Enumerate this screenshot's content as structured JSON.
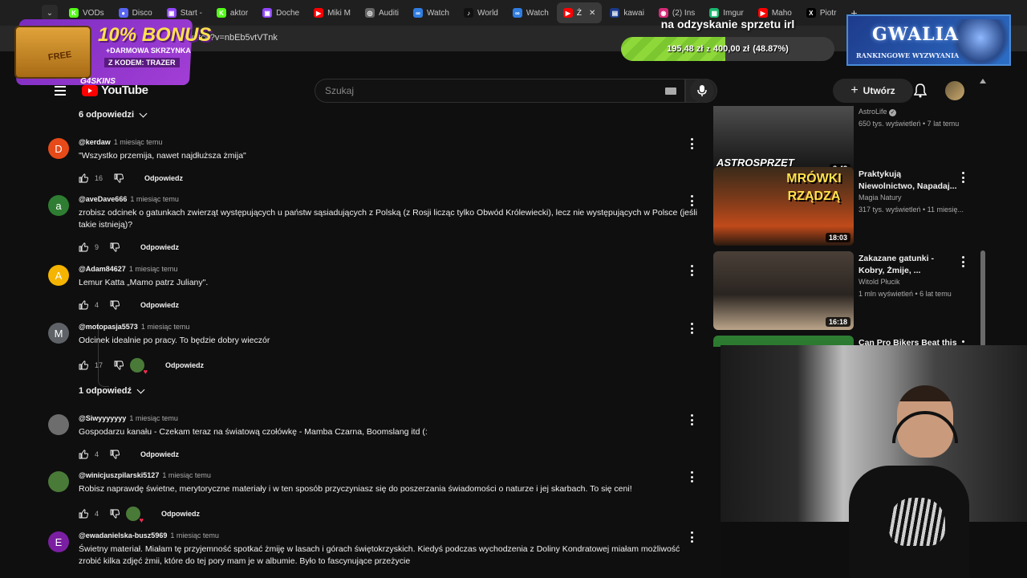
{
  "browser": {
    "tabs": [
      {
        "label": "",
        "color": "#3b3b3b",
        "glyph": "⌄",
        "active": false
      },
      {
        "label": "VODs",
        "color": "#53fc18",
        "glyph": "K",
        "active": false
      },
      {
        "label": "Disco",
        "color": "#5865f2",
        "glyph": "●",
        "active": false
      },
      {
        "label": "Start -",
        "color": "#9146ff",
        "glyph": "▣",
        "active": false
      },
      {
        "label": "aktor",
        "color": "#53fc18",
        "glyph": "K",
        "active": false
      },
      {
        "label": "Doche",
        "color": "#9146ff",
        "glyph": "▣",
        "active": false
      },
      {
        "label": "Miki M",
        "color": "#ff0000",
        "glyph": "▶",
        "active": false
      },
      {
        "label": "Auditi",
        "color": "#666666",
        "glyph": "◎",
        "active": false
      },
      {
        "label": "Watch",
        "color": "#2f7de1",
        "glyph": "∞",
        "active": false
      },
      {
        "label": "World",
        "color": "#111111",
        "glyph": "♪",
        "active": false
      },
      {
        "label": "Watch",
        "color": "#2f7de1",
        "glyph": "∞",
        "active": false
      },
      {
        "label": "Ż",
        "color": "#ff0000",
        "glyph": "▶",
        "active": true
      },
      {
        "label": "kawai",
        "color": "#1a3a8a",
        "glyph": "▤",
        "active": false
      },
      {
        "label": "(2) Ins",
        "color": "#d62976",
        "glyph": "◉",
        "active": false
      },
      {
        "label": "Imgur",
        "color": "#1bb76e",
        "glyph": "▦",
        "active": false
      },
      {
        "label": "Maho",
        "color": "#ff0000",
        "glyph": "▶",
        "active": false
      },
      {
        "label": "Piotr",
        "color": "#000000",
        "glyph": "X",
        "active": false
      }
    ],
    "new_tab": "+",
    "url": "/watch?v=nbEb5vtVTnk"
  },
  "youtube": {
    "logo_text": "YouTube",
    "search_placeholder": "Szukaj",
    "create_label": "Utwórz"
  },
  "comments": {
    "replies_toggle_top": "6 odpowiedzi",
    "replies_toggle_mid": "1 odpowiedź",
    "reply_label": "Odpowiedz",
    "items": [
      {
        "author": "@kerdaw",
        "time": "1 miesiąc temu",
        "text": "\"Wszystko przemija, nawet najdłuższa żmija\"",
        "likes": "16",
        "avatar_letter": "D",
        "avatar_color": "#e64a19"
      },
      {
        "author": "@aveDave666",
        "time": "1 miesiąc temu",
        "text": "zrobisz odcinek o gatunkach zwierząt występujących u państw sąsiadujących z Polską (z Rosji licząc tylko Obwód Królewiecki), lecz nie występujących w Polsce (jeśli takie istnieją)?",
        "likes": "9",
        "avatar_letter": "a",
        "avatar_color": "#2e7d32"
      },
      {
        "author": "@Adam84627",
        "time": "1 miesiąc temu",
        "text": "Lemur Katta „Mamo patrz Juliany\".",
        "likes": "4",
        "avatar_letter": "A",
        "avatar_color": "#f4b400"
      },
      {
        "author": "@motopasja5573",
        "time": "1 miesiąc temu",
        "text": "Odcinek idealnie po pracy. To będzie dobry wieczór",
        "likes": "17",
        "avatar_letter": "M",
        "avatar_color": "#5f6368"
      },
      {
        "author": "@Siwyyyyyyy",
        "time": "1 miesiąc temu",
        "text": "Gospodarzu kanału - Czekam teraz na światową czołówkę - Mamba Czarna, Boomslang itd (:",
        "likes": "4",
        "avatar_letter": "",
        "avatar_color": "#6d6d6d"
      },
      {
        "author": "@winicjuszpilarski5127",
        "time": "1 miesiąc temu",
        "text": "Robisz naprawdę świetne, merytoryczne materiały i w ten sposób przyczyniasz się do poszerzania świadomości o naturze i jej skarbach. To się ceni!",
        "likes": "4",
        "avatar_letter": "",
        "avatar_color": "#4a7a38"
      },
      {
        "author": "@ewadanielska-busz5969",
        "time": "1 miesiąc temu",
        "text": "Świetny  materiał. Miałam tę przyjemność spotkać żmiję w lasach i górach świętokrzyskich. Kiedyś podczas wychodzenia z Doliny Kondratowej miałam możliwość zrobić kilka zdjęć żmii, które do tej pory mam je w albumie. Było to fascynujące przeżycie",
        "likes": "",
        "avatar_letter": "E",
        "avatar_color": "#7b1fa2"
      }
    ]
  },
  "recommendations": [
    {
      "title": "",
      "channel": "AstroLife",
      "stats": "650 tys. wyświetleń • 7 lat temu",
      "duration": "8:43",
      "thumb_text": "ASTROSPRZĘT",
      "verified": true
    },
    {
      "title": "Praktykują Niewolnictwo, Napadaj...",
      "channel": "Magia Natury",
      "stats": "317 tys. wyświetleń • 11 miesię...",
      "duration": "18:03",
      "thumb_text": "MRÓWKI RZĄDZĄ",
      "verified": false
    },
    {
      "title": "Zakazane gatunki - Kobry, Żmije, ...",
      "channel": "Witold Płucik",
      "stats": "1 mln wyświetleń • 6 lat temu",
      "duration": "16:18",
      "thumb_text": "",
      "verified": false
    },
    {
      "title": "Can Pro Bikers Beat this",
      "channel": "",
      "stats": "",
      "duration": "",
      "thumb_text": "",
      "verified": false
    }
  ],
  "overlays": {
    "promo": {
      "big": "10% BONUS",
      "sub": "+DARMOWA SKRZYNKA",
      "code": "Z KODEM: TRAZER",
      "brand": "G4SKINS",
      "free": "FREE"
    },
    "goal": {
      "title": "na odzyskanie sprzetu irl",
      "current": "195,48 zł",
      "of": "z",
      "target": "400,00 zł",
      "percent": "(48.87%)",
      "progress": 0.4887
    },
    "gwalia": {
      "logo": "GWALIA",
      "sub": "RANKINGOWE WYZWYANIA"
    }
  }
}
